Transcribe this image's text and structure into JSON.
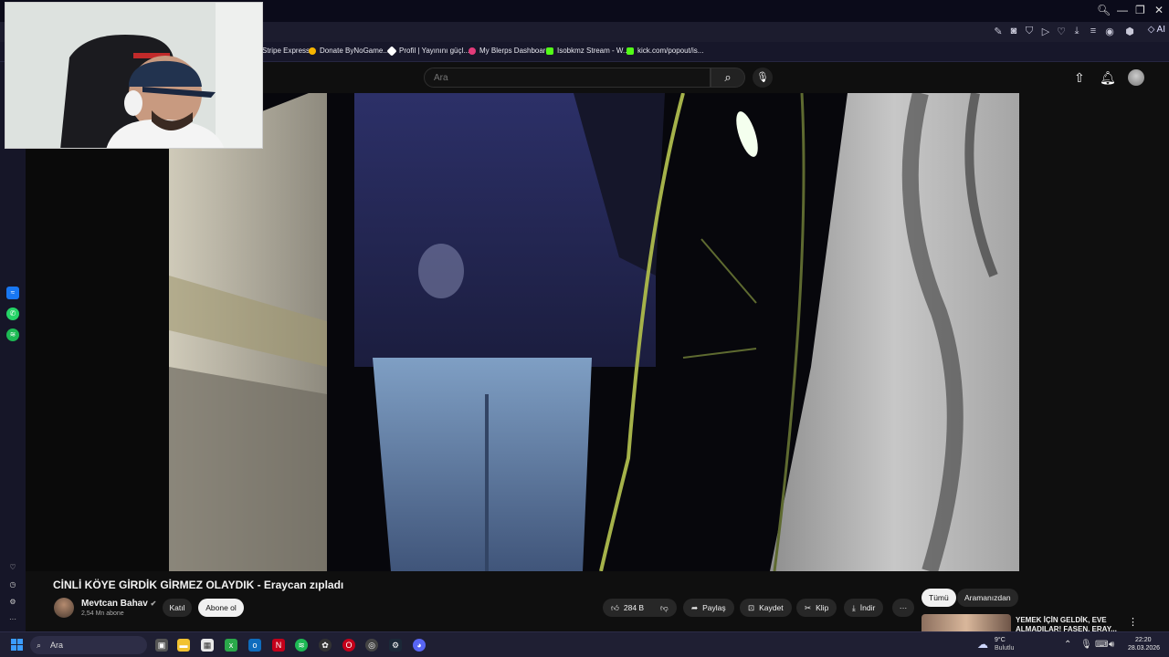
{
  "youtube": {
    "search_placeholder": "Ara",
    "video_title": "CİNLİ KÖYE GİRDİK GİRMEZ OLAYDIK - Eraycan zıpladı",
    "channel": {
      "name": "Mevtcan Bahav",
      "subscribers": "2,54 Mn abone",
      "verified": true
    },
    "join_label": "Katıl",
    "subscribe_label": "Abone ol",
    "actions": {
      "likes": "284 B",
      "share": "Paylaş",
      "save": "Kaydet",
      "clip": "Klip",
      "download": "İndir"
    },
    "sidebar": {
      "chips": [
        "Tümü",
        "Aramanızdan"
      ],
      "recommended_title": "YEMEK İÇİN GELDİK, EVE ALMADILAR! FAŞEN, ERAY..."
    }
  },
  "bookmarks": [
    {
      "label": "Stripe Express",
      "color": "#635bff"
    },
    {
      "label": "Donate ByNoGame...",
      "color": "#f5b400"
    },
    {
      "label": "Profil | Yayınını güçl...",
      "color": "#ffffff"
    },
    {
      "label": "My Blerps Dashboard",
      "color": "#e23b7a"
    },
    {
      "label": "Isobkmz Stream - W...",
      "color": "#53fc18"
    },
    {
      "label": "kick.com/popout/is...",
      "color": "#53fc18"
    }
  ],
  "browser": {
    "ai_label": "AI"
  },
  "taskbar": {
    "search_label": "Ara",
    "weather_temp": "9°C",
    "weather_desc": "Bulutlu",
    "time": "22:20",
    "date": "28.03.2026"
  },
  "colors": {
    "accent": "#3b9cff",
    "yt_bg": "#0f0f0f",
    "pill_bg": "#272727",
    "kick_green": "#53fc18"
  }
}
